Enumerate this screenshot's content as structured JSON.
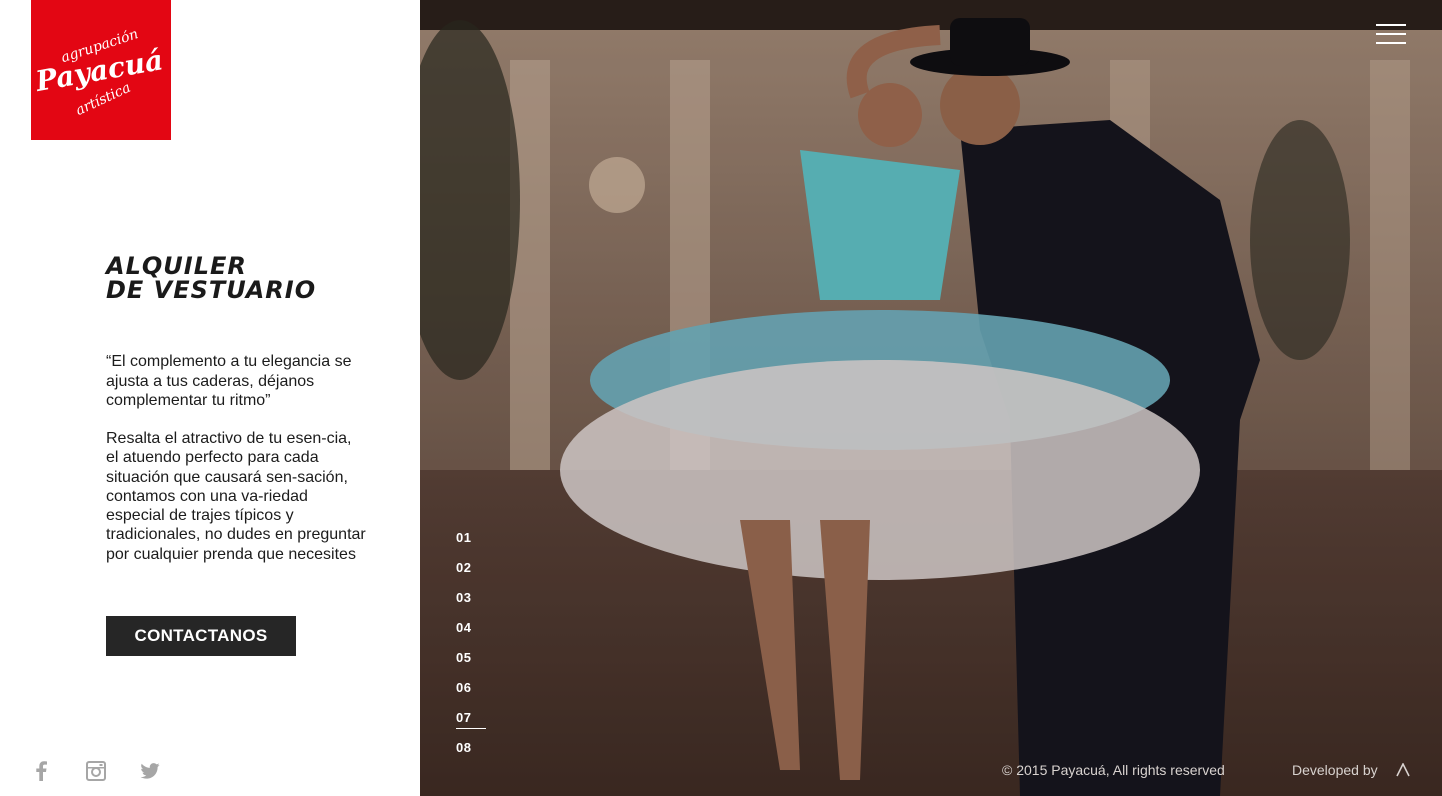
{
  "brand": {
    "logo_text_line1": "agrupación",
    "logo_text_line2": "Payacuá",
    "logo_text_line3": "artística",
    "color": "#e30613"
  },
  "page": {
    "title_line1": "Alquiler",
    "title_line2": "de vestuario",
    "quote": "“El complemento a tu elegancia se ajusta a tus caderas, déjanos complementar tu ritmo”",
    "body": "Resalta el atractivo de tu esen-cia, el atuendo perfecto para cada situación que causará sen-sación, contamos con una va-riedad especial de trajes típicos y tradicionales, no dudes en preguntar por cualquier prenda que necesites",
    "cta_label": "CONTACTANOS"
  },
  "social": {
    "icons": [
      "facebook-icon",
      "instagram-icon",
      "twitter-icon"
    ]
  },
  "slides": {
    "items": [
      "01",
      "02",
      "03",
      "04",
      "05",
      "06",
      "07",
      "08"
    ],
    "active_index": 6
  },
  "footer": {
    "copyright": "© 2015 Payacuá, All rights reserved",
    "developed_by": "Developed by"
  }
}
